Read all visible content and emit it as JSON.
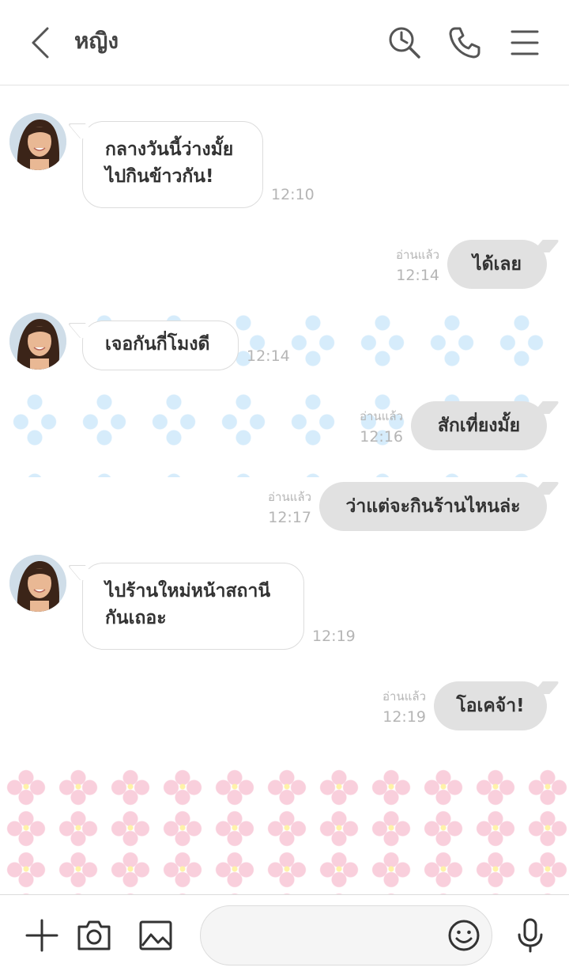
{
  "header": {
    "title": "หญิง"
  },
  "messages": [
    {
      "direction": "in",
      "lines": [
        "กลางวันนี้ว่างมั้ย",
        "ไปกินข้าวกัน!"
      ],
      "time": "12:10"
    },
    {
      "direction": "out",
      "text": "ได้เลย",
      "read": "อ่านแล้ว",
      "time": "12:14"
    },
    {
      "direction": "in",
      "lines": [
        "เจอกันกี่โมงดี"
      ],
      "time": "12:14"
    },
    {
      "direction": "out",
      "text": "สักเที่ยงมั้ย",
      "read": "อ่านแล้ว",
      "time": "12:16"
    },
    {
      "direction": "out",
      "text": "ว่าแต่จะกินร้านไหนล่ะ",
      "read": "อ่านแล้ว",
      "time": "12:17"
    },
    {
      "direction": "in",
      "lines": [
        "ไปร้านใหม่หน้าสถานี",
        "กันเถอะ"
      ],
      "time": "12:19"
    },
    {
      "direction": "out",
      "text": "โอเคจ้า!",
      "read": "อ่านแล้ว",
      "time": "12:19"
    }
  ],
  "composer": {
    "placeholder": ""
  },
  "icons": {
    "back": "chevron-left-icon",
    "search": "clock-search-icon",
    "call": "phone-icon",
    "menu": "hamburger-icon",
    "plus": "plus-icon",
    "camera": "camera-icon",
    "image": "image-icon",
    "emoji": "smiley-icon",
    "mic": "microphone-icon"
  },
  "colors": {
    "outgoing_bubble": "#e1e1e1",
    "incoming_bubble": "#ffffff",
    "pattern_blue": "#cfe9fb",
    "pattern_pink": "#f9cfdc"
  }
}
